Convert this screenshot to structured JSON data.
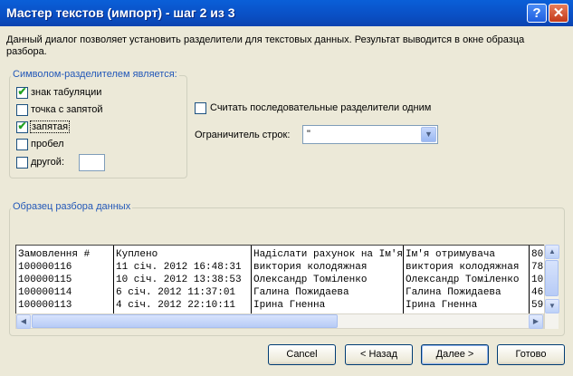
{
  "window": {
    "title": "Мастер текстов (импорт) - шаг 2 из 3",
    "help_glyph": "?",
    "close_glyph": "✕"
  },
  "description": "Данный диалог позволяет установить разделители для текстовых данных. Результат выводится в окне образца разбора.",
  "delimiters": {
    "legend": "Символом-разделителем является:",
    "items": [
      {
        "label": "знак табуляции",
        "checked": true
      },
      {
        "label": "точка с запятой",
        "checked": false
      },
      {
        "label": "запятая",
        "checked": true
      },
      {
        "label": "пробел",
        "checked": false
      },
      {
        "label": "другой:",
        "checked": false
      }
    ],
    "other_value": ""
  },
  "consecutive": {
    "label": "Считать последовательные разделители одним",
    "checked": false
  },
  "text_qualifier": {
    "label": "Ограничитель строк:",
    "value": "\""
  },
  "preview": {
    "legend": "Образец разбора данных",
    "rows": [
      [
        "Замовлення #",
        "Куплено",
        "Надіслати рахунок на Ім'я",
        "Ім'я отримувача",
        "80"
      ],
      [
        "100000116",
        "11 січ. 2012 16:48:31",
        "виктория колодяжная",
        "виктория колодяжная",
        "78"
      ],
      [
        "100000115",
        "10 січ. 2012 13:38:53",
        "Олександр Томіленко",
        "Олександр Томіленко",
        "10"
      ],
      [
        "100000114",
        "6 січ. 2012 11:37:01",
        "Галина Пожидаева",
        "Галина Пожидаева",
        "46"
      ],
      [
        "100000113",
        "4 січ. 2012 22:10:11",
        "Ірина Гненна",
        "Ірина Гненна",
        "59"
      ]
    ]
  },
  "buttons": {
    "cancel": "Cancel",
    "back": "< Назад",
    "next": "Далее >",
    "finish": "Готово"
  }
}
